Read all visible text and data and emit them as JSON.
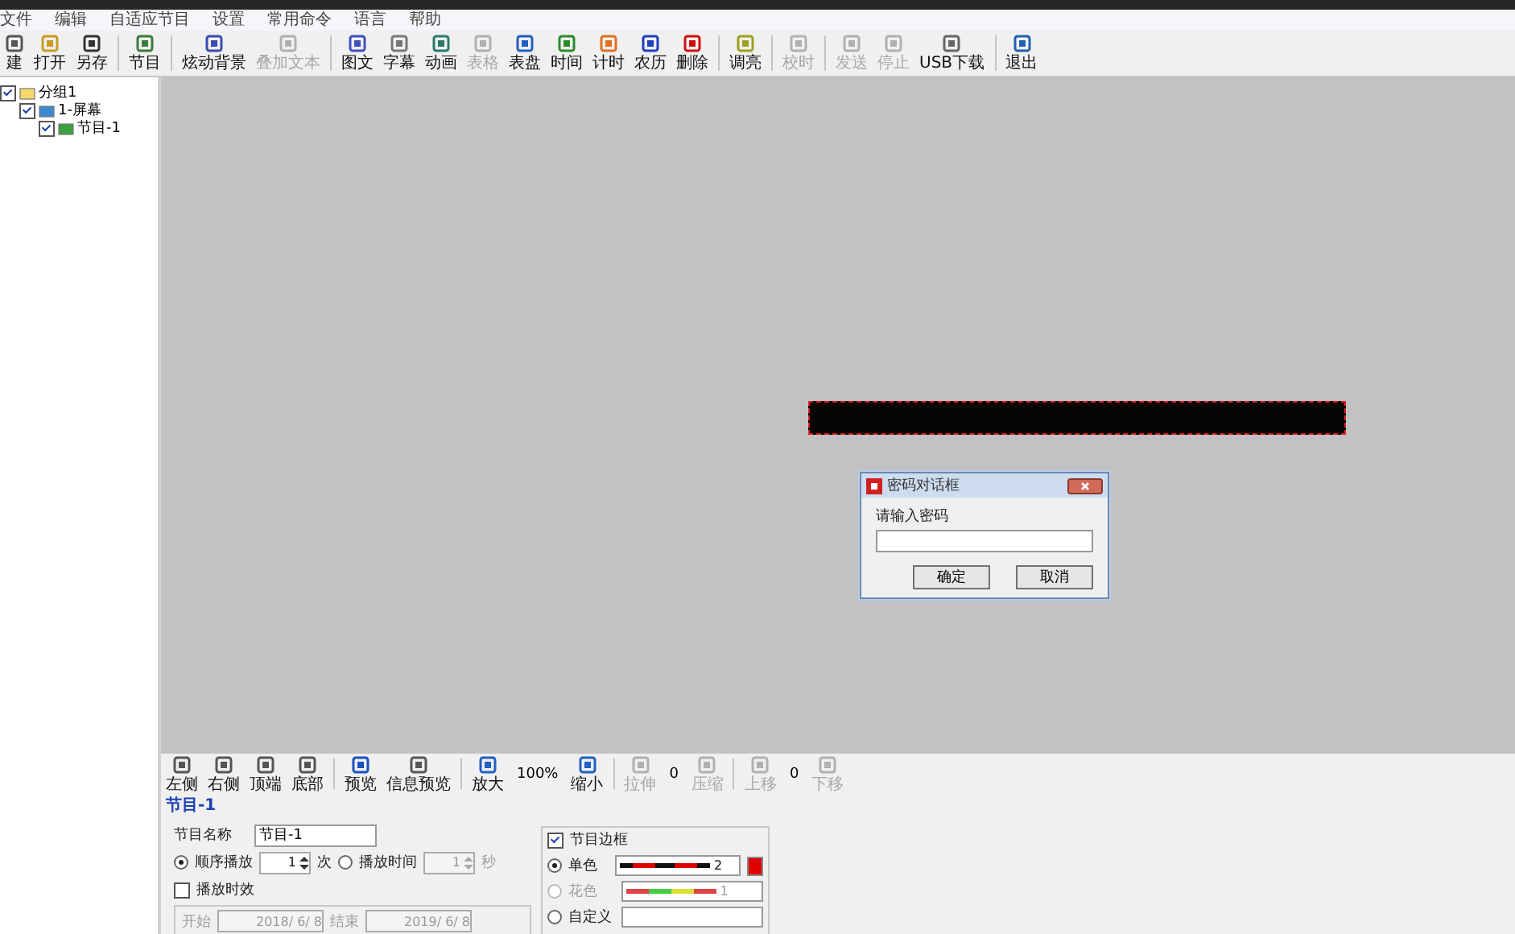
{
  "menu": [
    "文件",
    "编辑",
    "自适应节目",
    "设置",
    "常用命令",
    "语言",
    "帮助"
  ],
  "toolbar": [
    {
      "kind": "button",
      "label": "建",
      "disabled": false
    },
    {
      "kind": "button",
      "label": "打开",
      "disabled": false
    },
    {
      "kind": "button",
      "label": "另存",
      "disabled": false
    },
    {
      "kind": "separator"
    },
    {
      "kind": "button",
      "label": "节目",
      "disabled": false
    },
    {
      "kind": "separator"
    },
    {
      "kind": "button",
      "label": "炫动背景",
      "disabled": false
    },
    {
      "kind": "button",
      "label": "叠加文本",
      "disabled": true
    },
    {
      "kind": "separator"
    },
    {
      "kind": "button",
      "label": "图文",
      "disabled": false
    },
    {
      "kind": "button",
      "label": "字幕",
      "disabled": false
    },
    {
      "kind": "button",
      "label": "动画",
      "disabled": false
    },
    {
      "kind": "button",
      "label": "表格",
      "disabled": true
    },
    {
      "kind": "button",
      "label": "表盘",
      "disabled": false
    },
    {
      "kind": "button",
      "label": "时间",
      "disabled": false
    },
    {
      "kind": "button",
      "label": "计时",
      "disabled": false
    },
    {
      "kind": "button",
      "label": "农历",
      "disabled": false
    },
    {
      "kind": "button",
      "label": "删除",
      "disabled": false
    },
    {
      "kind": "separator"
    },
    {
      "kind": "button",
      "label": "调亮",
      "disabled": false
    },
    {
      "kind": "separator"
    },
    {
      "kind": "button",
      "label": "校时",
      "disabled": true
    },
    {
      "kind": "separator"
    },
    {
      "kind": "button",
      "label": "发送",
      "disabled": true
    },
    {
      "kind": "button",
      "label": "停止",
      "disabled": true
    },
    {
      "kind": "button",
      "label": "USB下载",
      "disabled": false
    },
    {
      "kind": "separator"
    },
    {
      "kind": "button",
      "label": "退出",
      "disabled": false
    }
  ],
  "tree": [
    {
      "label": "分组1",
      "checked": true,
      "children": [
        {
          "label": "1-屏幕",
          "checked": true,
          "children": [
            {
              "label": "节目-1",
              "checked": true
            }
          ]
        }
      ]
    }
  ],
  "dialog": {
    "title": "密码对话框",
    "prompt": "请输入密码",
    "buttons": [
      "确定",
      "取消"
    ]
  },
  "bottom_toolbar": [
    {
      "kind": "button",
      "label": "左侧",
      "disabled": false
    },
    {
      "kind": "button",
      "label": "右侧",
      "disabled": false
    },
    {
      "kind": "button",
      "label": "顶端",
      "disabled": false
    },
    {
      "kind": "button",
      "label": "底部",
      "disabled": false
    },
    {
      "kind": "separator"
    },
    {
      "kind": "button",
      "label": "预览",
      "disabled": false
    },
    {
      "kind": "button",
      "label": "信息预览",
      "disabled": false
    },
    {
      "kind": "separator"
    },
    {
      "kind": "button",
      "label": "放大",
      "disabled": false
    },
    {
      "kind": "value",
      "label": "100%"
    },
    {
      "kind": "button",
      "label": "缩小",
      "disabled": false
    },
    {
      "kind": "separator"
    },
    {
      "kind": "button",
      "label": "拉伸",
      "disabled": true
    },
    {
      "kind": "value",
      "label": "0"
    },
    {
      "kind": "button",
      "label": "压缩",
      "disabled": true
    },
    {
      "kind": "separator"
    },
    {
      "kind": "button",
      "label": "上移",
      "disabled": true
    },
    {
      "kind": "value",
      "label": "0"
    },
    {
      "kind": "button",
      "label": "下移",
      "disabled": true
    }
  ],
  "panel": {
    "title": "节目-1",
    "name_label": "节目名称",
    "name_value": "节目-1",
    "play_modes": [
      {
        "label": "顺序播放",
        "selected": true,
        "value": "1",
        "unit": "次"
      },
      {
        "label": "播放时间",
        "selected": false,
        "value": "1",
        "unit": "秒"
      }
    ],
    "validity": {
      "label": "播放时效",
      "checked": false,
      "start_label": "开始",
      "start": "2018/ 6/ 8",
      "end_label": "结束",
      "end": "2019/ 6/ 8"
    },
    "border": {
      "label": "节目边框",
      "checked": true,
      "options": [
        {
          "label": "单色",
          "selected": true,
          "disabled": false,
          "kind": "mono",
          "value": "2"
        },
        {
          "label": "花色",
          "selected": false,
          "disabled": true,
          "kind": "multi",
          "value": "1"
        },
        {
          "label": "自定义",
          "selected": false,
          "disabled": false,
          "kind": "custom"
        }
      ]
    }
  }
}
